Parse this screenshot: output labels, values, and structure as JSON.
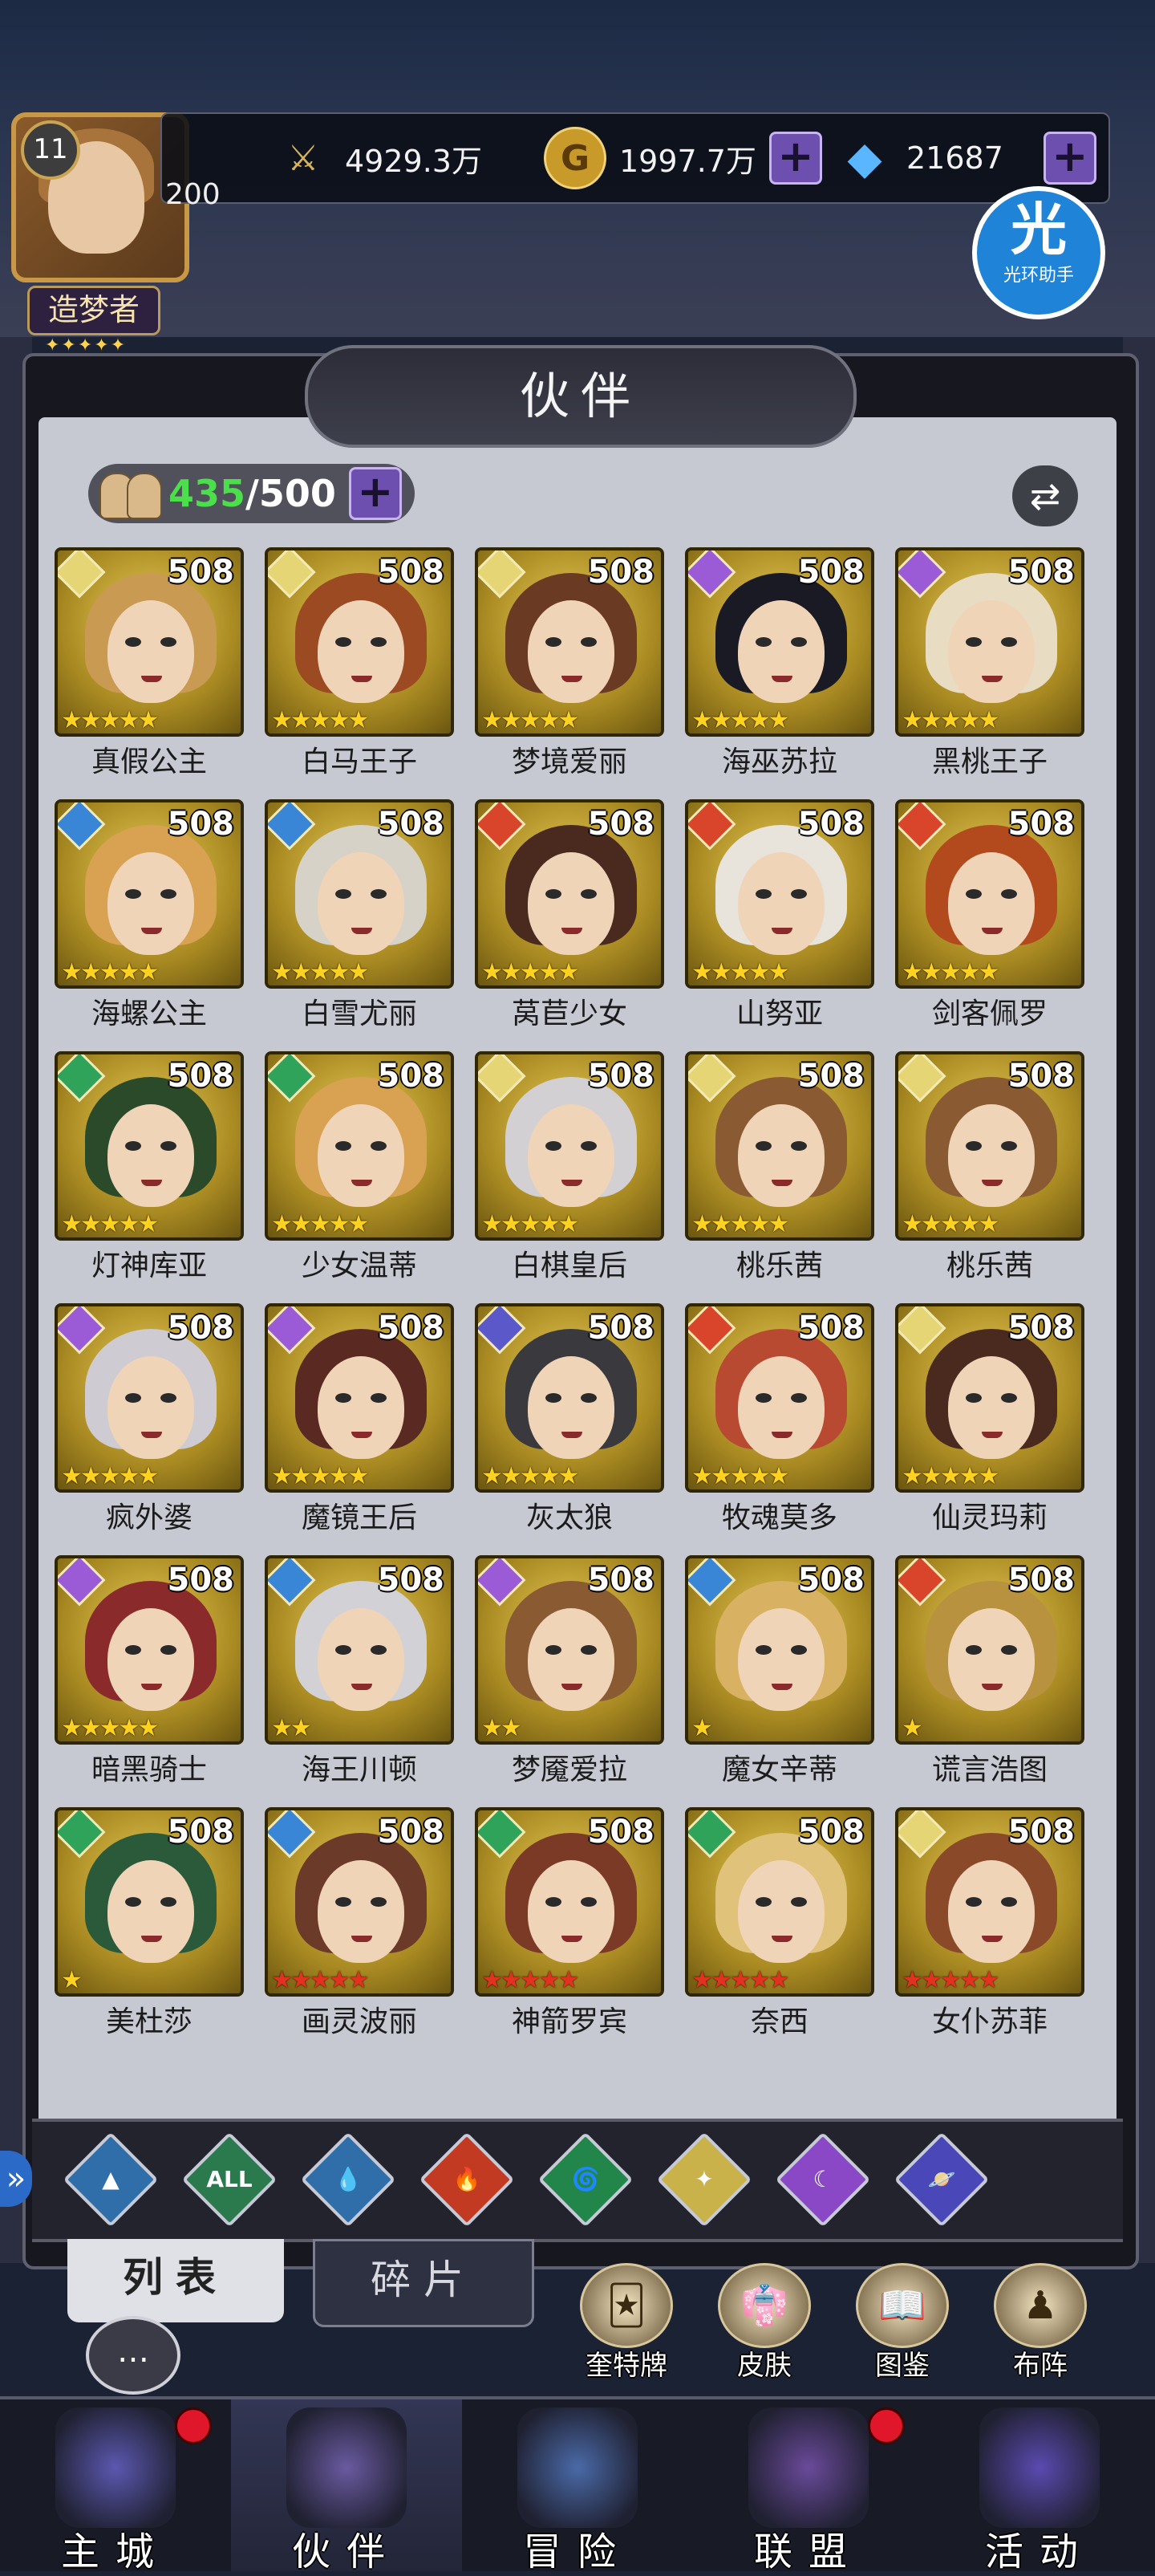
{
  "player": {
    "level": "11",
    "power": "200",
    "title": "造梦者"
  },
  "resources": {
    "stamina": "4929.3万",
    "gold": "1997.7万",
    "diamond": "21687"
  },
  "halo_assistant": {
    "glyph": "光",
    "label": "光环助手"
  },
  "section_title": "伙伴",
  "partner_count": {
    "current": "435",
    "max": "/500"
  },
  "colors": {
    "light": "#e6d574",
    "water": "#3a86d6",
    "fire": "#d9452a",
    "wind": "#2fa35a",
    "dark": "#9b5ad6",
    "planet": "#5b58c9",
    "star_gold": "#ffd21f",
    "star_red": "#e3311f",
    "accent_purple": "#6d4fb0"
  },
  "heroes": [
    {
      "name": "真假公主",
      "level": "508",
      "element": "light",
      "stars": 5,
      "star_color": "gold",
      "hair": "#c89a52"
    },
    {
      "name": "白马王子",
      "level": "508",
      "element": "light",
      "stars": 5,
      "star_color": "gold",
      "hair": "#9b4a22"
    },
    {
      "name": "梦境爱丽",
      "level": "508",
      "element": "light",
      "stars": 5,
      "star_color": "gold",
      "hair": "#6b3a22"
    },
    {
      "name": "海巫苏拉",
      "level": "508",
      "element": "dark",
      "stars": 5,
      "star_color": "gold",
      "hair": "#1a1a24"
    },
    {
      "name": "黑桃王子",
      "level": "508",
      "element": "dark",
      "stars": 5,
      "star_color": "gold",
      "hair": "#e8dcc2"
    },
    {
      "name": "海螺公主",
      "level": "508",
      "element": "water",
      "stars": 5,
      "star_color": "gold",
      "hair": "#d8a252"
    },
    {
      "name": "白雪尤丽",
      "level": "508",
      "element": "water",
      "stars": 5,
      "star_color": "gold",
      "hair": "#d6d2c8"
    },
    {
      "name": "莴苣少女",
      "level": "508",
      "element": "fire",
      "stars": 5,
      "star_color": "gold",
      "hair": "#4a2a1e"
    },
    {
      "name": "山努亚",
      "level": "508",
      "element": "fire",
      "stars": 5,
      "star_color": "gold",
      "hair": "#e8e4dc"
    },
    {
      "name": "剑客佩罗",
      "level": "508",
      "element": "fire",
      "stars": 5,
      "star_color": "gold",
      "hair": "#b24a1e"
    },
    {
      "name": "灯神库亚",
      "level": "508",
      "element": "wind",
      "stars": 5,
      "star_color": "gold",
      "hair": "#2a4a2a"
    },
    {
      "name": "少女温蒂",
      "level": "508",
      "element": "wind",
      "stars": 5,
      "star_color": "gold",
      "hair": "#d8a252"
    },
    {
      "name": "白棋皇后",
      "level": "508",
      "element": "light",
      "stars": 5,
      "star_color": "gold",
      "hair": "#d2d0d2"
    },
    {
      "name": "桃乐茜",
      "level": "508",
      "element": "light",
      "stars": 5,
      "star_color": "gold",
      "hair": "#8a5a32"
    },
    {
      "name": "桃乐茜",
      "level": "508",
      "element": "light",
      "stars": 5,
      "star_color": "gold",
      "hair": "#8a5a32"
    },
    {
      "name": "疯外婆",
      "level": "508",
      "element": "dark",
      "stars": 5,
      "star_color": "gold",
      "hair": "#cfcbd2"
    },
    {
      "name": "魔镜王后",
      "level": "508",
      "element": "dark",
      "stars": 5,
      "star_color": "gold",
      "hair": "#5a2a22"
    },
    {
      "name": "灰太狼",
      "level": "508",
      "element": "planet",
      "stars": 5,
      "star_color": "gold",
      "hair": "#3a3a3e"
    },
    {
      "name": "牧魂莫多",
      "level": "508",
      "element": "fire",
      "stars": 5,
      "star_color": "gold",
      "hair": "#b84a32"
    },
    {
      "name": "仙灵玛莉",
      "level": "508",
      "element": "light",
      "stars": 5,
      "star_color": "gold",
      "hair": "#4a2a1e"
    },
    {
      "name": "暗黑骑士",
      "level": "508",
      "element": "dark",
      "stars": 5,
      "star_color": "gold",
      "hair": "#8a2a2a"
    },
    {
      "name": "海王川顿",
      "level": "508",
      "element": "water",
      "stars": 2,
      "star_color": "gold",
      "hair": "#d2d2d6"
    },
    {
      "name": "梦魇爱拉",
      "level": "508",
      "element": "dark",
      "stars": 2,
      "star_color": "gold",
      "hair": "#8a5a32"
    },
    {
      "name": "魔女辛蒂",
      "level": "508",
      "element": "water",
      "stars": 1,
      "star_color": "gold",
      "hair": "#d8b262"
    },
    {
      "name": "谎言浩图",
      "level": "508",
      "element": "fire",
      "stars": 1,
      "star_color": "gold",
      "hair": "#b8923e"
    },
    {
      "name": "美杜莎",
      "level": "508",
      "element": "wind",
      "stars": 1,
      "star_color": "gold",
      "hair": "#2a5a3a"
    },
    {
      "name": "画灵波丽",
      "level": "508",
      "element": "water",
      "stars": 5,
      "star_color": "red",
      "hair": "#6b3a28"
    },
    {
      "name": "神箭罗宾",
      "level": "508",
      "element": "wind",
      "stars": 5,
      "star_color": "red",
      "hair": "#7a3a26"
    },
    {
      "name": "奈西",
      "level": "508",
      "element": "wind",
      "stars": 5,
      "star_color": "red",
      "hair": "#e0c27a"
    },
    {
      "name": "女仆苏菲",
      "level": "508",
      "element": "light",
      "stars": 5,
      "star_color": "red",
      "hair": "#8a4a2a"
    }
  ],
  "filters": [
    {
      "name": "light",
      "glyph": "▲",
      "color": "#2f6ea8"
    },
    {
      "name": "all",
      "glyph": "ALL",
      "color": "#2a7a4e"
    },
    {
      "name": "water",
      "glyph": "💧",
      "color": "#2f6ea8"
    },
    {
      "name": "fire",
      "glyph": "🔥",
      "color": "#c23a22"
    },
    {
      "name": "wind",
      "glyph": "🌀",
      "color": "#22864a"
    },
    {
      "name": "light2",
      "glyph": "✦",
      "color": "#c9b24a"
    },
    {
      "name": "dark",
      "glyph": "☾",
      "color": "#8a48c6"
    },
    {
      "name": "planet",
      "glyph": "🪐",
      "color": "#4a48b8"
    }
  ],
  "tabs": {
    "list": "列表",
    "shards": "碎片"
  },
  "shortcuts": [
    {
      "label": "奎特牌",
      "glyph": "🃏"
    },
    {
      "label": "皮肤",
      "glyph": "👘"
    },
    {
      "label": "图鉴",
      "glyph": "📖"
    },
    {
      "label": "布阵",
      "glyph": "♟"
    }
  ],
  "chat": {
    "label": "聊天",
    "glyph": "…"
  },
  "nav": [
    {
      "label": "主城",
      "active": false,
      "badge": true,
      "color": "#5b58b0"
    },
    {
      "label": "伙伴",
      "active": true,
      "badge": false,
      "color": "#6a5aa0"
    },
    {
      "label": "冒险",
      "active": false,
      "badge": false,
      "color": "#4a6aa8"
    },
    {
      "label": "联盟",
      "active": false,
      "badge": true,
      "color": "#6a4a9a"
    },
    {
      "label": "活动",
      "active": false,
      "badge": false,
      "color": "#5a4ab0"
    }
  ]
}
